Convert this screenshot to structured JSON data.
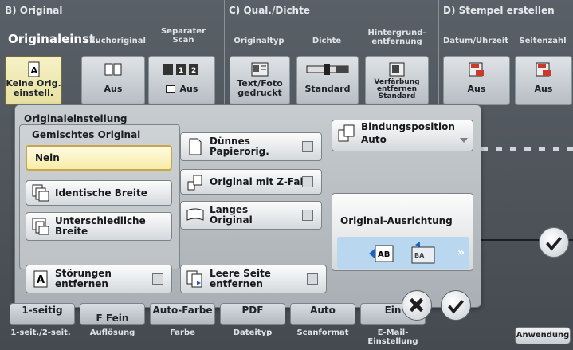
{
  "top": {
    "sections": [
      {
        "label": "B) Original"
      },
      {
        "label": "C) Qual./Dichte"
      },
      {
        "label": "D) Stempel erstellen"
      }
    ],
    "sub_b": [
      "Originaleinst.",
      "Buchoriginal",
      "Separater Scan"
    ],
    "sub_c": [
      "Originaltyp",
      "Dichte",
      "Hintergrund-\nentfernung"
    ],
    "sub_d": [
      "Datum/Uhrzeit",
      "Seitenzahl"
    ],
    "tiles": [
      {
        "label": "Keine Orig.\neinstell."
      },
      {
        "label": "Aus"
      },
      {
        "label": "Aus"
      },
      {
        "label": "Text/Foto\ngedruckt"
      },
      {
        "label": "Standard"
      },
      {
        "label": "Verfärbung\nentfernen\nStandard"
      },
      {
        "label": "Aus"
      },
      {
        "label": "Aus"
      }
    ]
  },
  "panel": {
    "title": "Originaleinstellung",
    "group_title": "Gemischtes Original",
    "mixed": {
      "nein": "Nein",
      "identisch": "Identische Breite",
      "unterschiedlich": "Unterschiedliche\nBreite"
    },
    "opts": {
      "duenn": "Dünnes\nPapierorig.",
      "zfalz": "Original mit Z-Falz",
      "lang": "Langes\nOriginal",
      "stoer": "Störungen\nentfernen",
      "leer": "Leere Seite\nentfernen"
    },
    "binding": {
      "title": "Bindungsposition",
      "value": "Auto"
    },
    "ausrichtung": "Original-Ausrichtung"
  },
  "bottom": {
    "values": [
      "1-seitig",
      "F Fein",
      "Auto-Farbe",
      "PDF",
      "Auto",
      "Ein"
    ],
    "labels": [
      "1-seit./2-seit.",
      "Auflösung",
      "Farbe",
      "Dateityp",
      "Scanformat",
      "E-Mail-\nEinstellung"
    ],
    "anwendung": "Anwendung"
  },
  "colors": {
    "accent": "#f7eca9",
    "panel": "#b9bec3",
    "header": "#555b61"
  }
}
